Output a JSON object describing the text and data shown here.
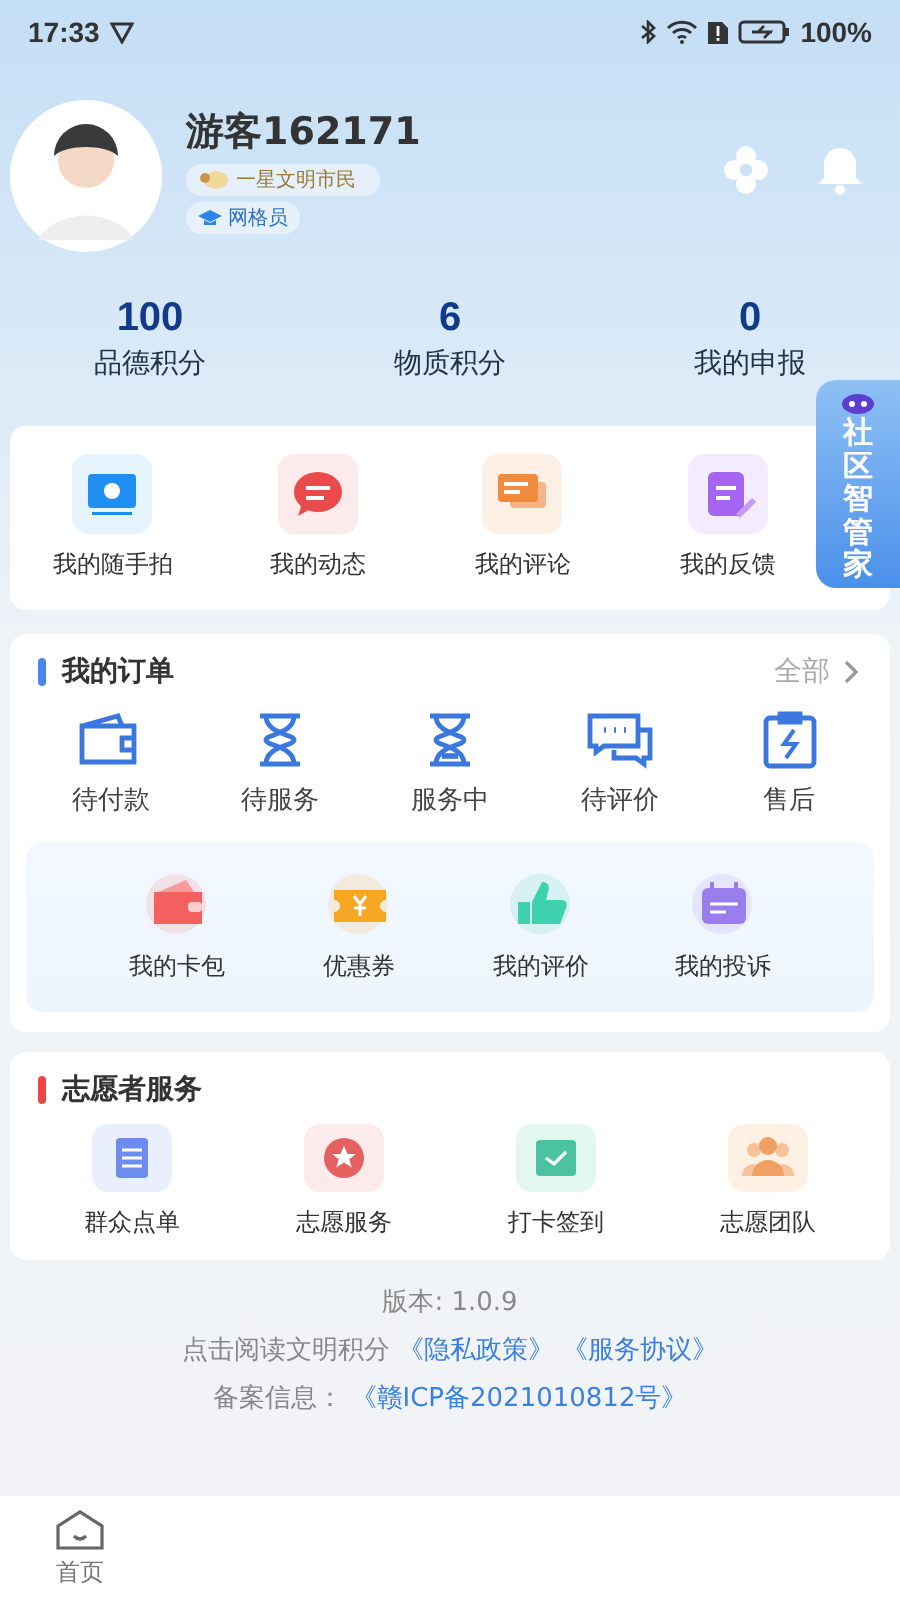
{
  "status_bar": {
    "time": "17:33",
    "battery": "100%"
  },
  "profile": {
    "name": "游客162171",
    "badges": [
      {
        "label": "一星文明市民",
        "kind": "level"
      },
      {
        "label": "网格员",
        "kind": "role"
      }
    ]
  },
  "stats": [
    {
      "value": "100",
      "label": "品德积分"
    },
    {
      "value": "6",
      "label": "物质积分"
    },
    {
      "value": "0",
      "label": "我的申报"
    }
  ],
  "quick_actions": [
    {
      "label": "我的随手拍",
      "kind": "camera"
    },
    {
      "label": "我的动态",
      "kind": "chat"
    },
    {
      "label": "我的评论",
      "kind": "comments"
    },
    {
      "label": "我的反馈",
      "kind": "feedback"
    }
  ],
  "floating_tab": {
    "label": "社区智管家"
  },
  "orders": {
    "title": "我的订单",
    "more": "全部",
    "items": [
      {
        "label": "待付款",
        "kind": "wallet"
      },
      {
        "label": "待服务",
        "kind": "hourglass"
      },
      {
        "label": "服务中",
        "kind": "hourglass-half"
      },
      {
        "label": "待评价",
        "kind": "bubbles"
      },
      {
        "label": "售后",
        "kind": "clipboard"
      }
    ],
    "extras": [
      {
        "label": "我的卡包",
        "kind": "cardbag"
      },
      {
        "label": "优惠券",
        "kind": "coupon"
      },
      {
        "label": "我的评价",
        "kind": "thumb"
      },
      {
        "label": "我的投诉",
        "kind": "complaint"
      }
    ]
  },
  "volunteer": {
    "title": "志愿者服务",
    "items": [
      {
        "label": "群众点单",
        "kind": "list"
      },
      {
        "label": "志愿服务",
        "kind": "star"
      },
      {
        "label": "打卡签到",
        "kind": "checkin"
      },
      {
        "label": "志愿团队",
        "kind": "team"
      }
    ]
  },
  "footer": {
    "version": "版本: 1.0.9",
    "agreement_text": "点击阅读文明积分",
    "links": [
      "《隐私政策》",
      "《服务协议》"
    ],
    "record_label": "备案信息：",
    "record_link": "《赣ICP备2021010812号》"
  },
  "tab_bar": [
    {
      "label": "首页",
      "kind": "home"
    }
  ]
}
